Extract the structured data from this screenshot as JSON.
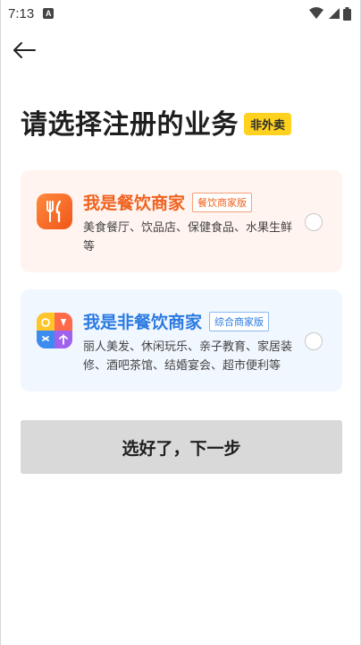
{
  "status_bar": {
    "time": "7:13",
    "app_icon_letter": "A"
  },
  "header": {
    "back_icon": "arrow-left-icon"
  },
  "title": {
    "text": "请选择注册的业务",
    "badge": "非外卖"
  },
  "options": [
    {
      "title": "我是餐饮商家",
      "tag": "餐饮商家版",
      "description": "美食餐厅、饮品店、保健食品、水果生鲜等",
      "icon": "utensils-icon",
      "accent": "#f0621f",
      "selected": false
    },
    {
      "title": "我是非餐饮商家",
      "tag": "综合商家版",
      "description": "丽人美发、休闲玩乐、亲子教育、家居装修、酒吧茶馆、结婚宴会、超市便利等",
      "icon": "multi-category-icon",
      "accent": "#2a7ae2",
      "selected": false
    }
  ],
  "next_button": {
    "label": "选好了，下一步",
    "enabled": false
  },
  "colors": {
    "badge_yellow": "#ffd21f",
    "button_disabled": "#d9d9d9"
  }
}
